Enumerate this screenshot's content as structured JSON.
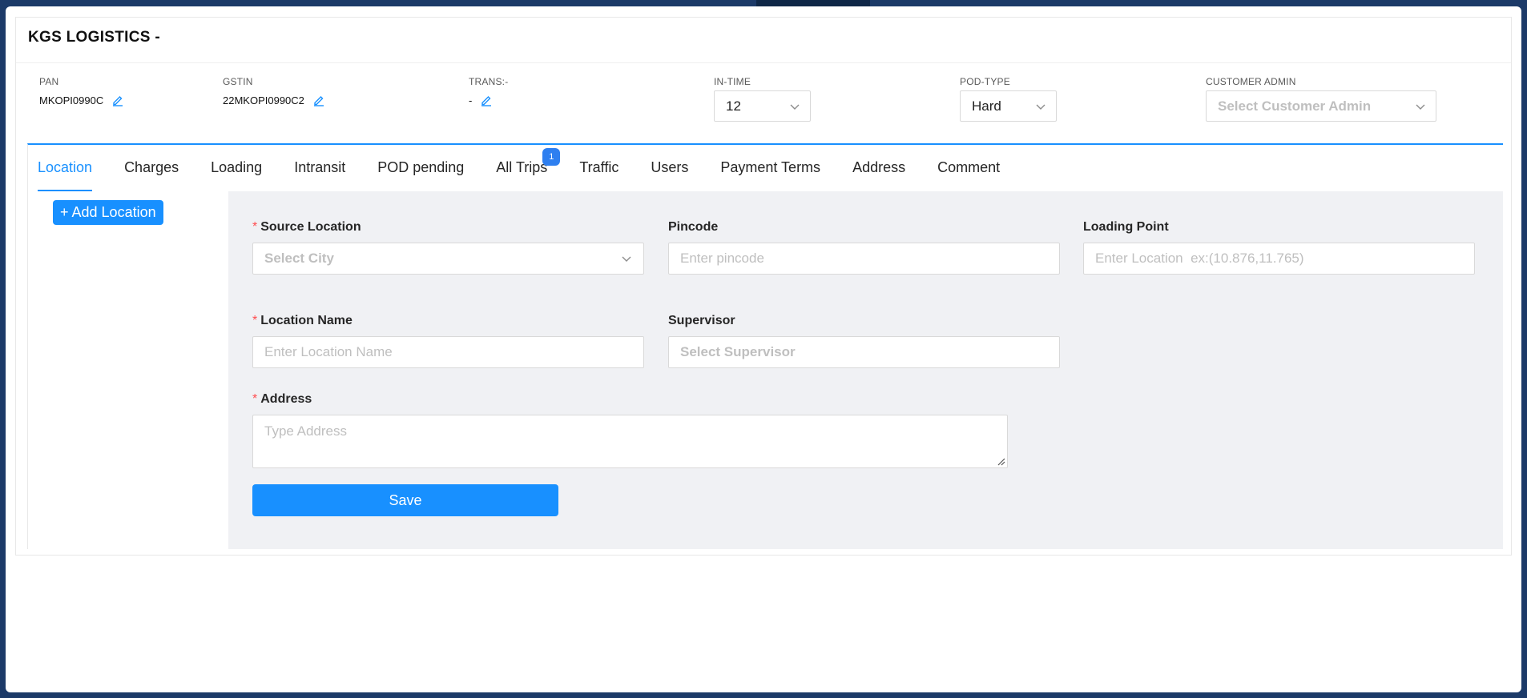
{
  "company": {
    "title": "KGS LOGISTICS -"
  },
  "info": {
    "pan": {
      "label": "PAN",
      "value": "MKOPI0990C"
    },
    "gstin": {
      "label": "GSTIN",
      "value": "22MKOPI0990C2"
    },
    "trans": {
      "label": "TRANS:-",
      "value": "-"
    },
    "in_time": {
      "label": "IN-TIME",
      "value": "12"
    },
    "pod_type": {
      "label": "POD-TYPE",
      "value": "Hard"
    },
    "customer_admin": {
      "label": "CUSTOMER ADMIN",
      "placeholder": "Select Customer Admin"
    }
  },
  "tabs": [
    {
      "label": "Location",
      "active": true
    },
    {
      "label": "Charges"
    },
    {
      "label": "Loading"
    },
    {
      "label": "Intransit"
    },
    {
      "label": "POD pending"
    },
    {
      "label": "All Trips",
      "badge": "1"
    },
    {
      "label": "Traffic"
    },
    {
      "label": "Users"
    },
    {
      "label": "Payment Terms"
    },
    {
      "label": "Address"
    },
    {
      "label": "Comment"
    }
  ],
  "left_panel": {
    "add_button": "+ Add Location"
  },
  "form": {
    "source_location": {
      "label": "Source Location",
      "placeholder": "Select City"
    },
    "pincode": {
      "label": "Pincode",
      "placeholder": "Enter pincode"
    },
    "loading_point": {
      "label": "Loading Point",
      "placeholder": "Enter Location  ex:(10.876,11.765)"
    },
    "location_name": {
      "label": "Location Name",
      "placeholder": "Enter Location Name"
    },
    "supervisor": {
      "label": "Supervisor",
      "placeholder": "Select Supervisor"
    },
    "address": {
      "label": "Address",
      "placeholder": "Type Address"
    },
    "required_mark": "*",
    "save_label": "Save"
  },
  "colors": {
    "primary": "#1890ff",
    "background": "#1c3a68",
    "panel": "#f0f1f4",
    "required": "#ff4d4f"
  }
}
